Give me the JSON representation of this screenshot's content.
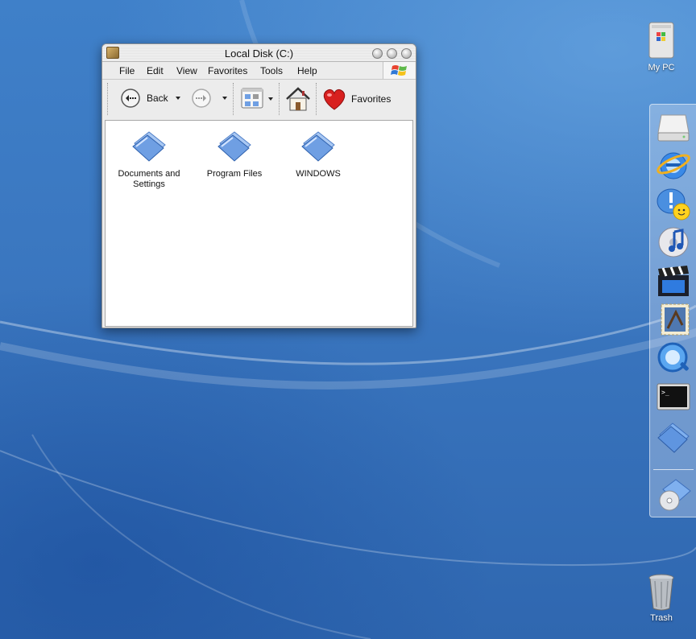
{
  "window": {
    "title": "Local Disk (C:)",
    "menu": [
      "File",
      "Edit",
      "View",
      "Favorites",
      "Tools",
      "Help"
    ],
    "toolbar": {
      "back_label": "Back",
      "favorites_label": "Favorites"
    },
    "items": [
      {
        "label_line1": "Documents and",
        "label_line2": "Settings",
        "icon": "folder-icon"
      },
      {
        "label_line1": "Program Files",
        "label_line2": "",
        "icon": "folder-icon"
      },
      {
        "label_line1": "WINDOWS",
        "label_line2": "",
        "icon": "folder-icon"
      }
    ]
  },
  "desktop": {
    "my_pc_label": "My PC",
    "trash_label": "Trash"
  },
  "dock": {
    "items": [
      "hard-drive-icon",
      "internet-explorer-icon",
      "messenger-icon",
      "itunes-icon",
      "movie-maker-icon",
      "mail-icon",
      "quicktime-icon",
      "terminal-icon",
      "folder-icon",
      "disc-burner-icon"
    ]
  },
  "colors": {
    "desktop_blue": "#3b79c2",
    "folder_blue": "#6f9fe3",
    "window_chrome": "#ececec"
  }
}
